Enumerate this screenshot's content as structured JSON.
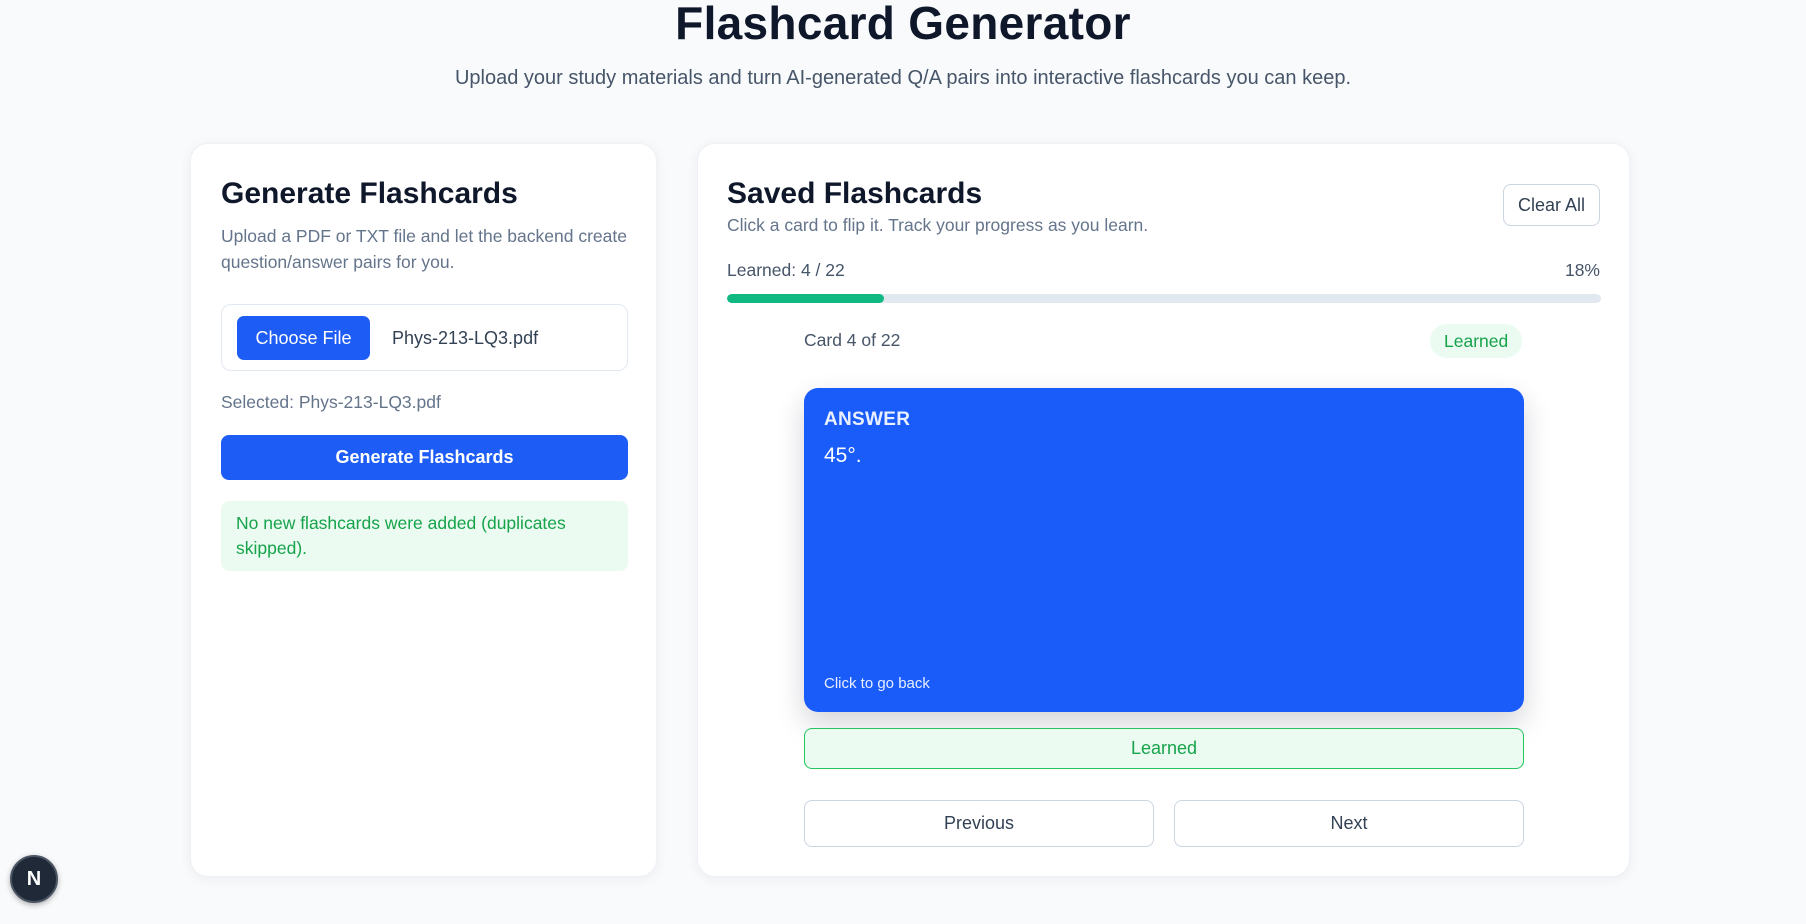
{
  "header": {
    "title": "Flashcard Generator",
    "subtitle": "Upload your study materials and turn AI-generated Q/A pairs into interactive flashcards you can keep."
  },
  "generate": {
    "heading": "Generate Flashcards",
    "description": "Upload a PDF or TXT file and let the backend create question/answer pairs for you.",
    "choose_file_label": "Choose File",
    "file_name": "Phys-213-LQ3.pdf",
    "selected_text": "Selected: Phys-213-LQ3.pdf",
    "generate_button": "Generate Flashcards",
    "notice": "No new flashcards were added (duplicates skipped)."
  },
  "saved": {
    "heading": "Saved Flashcards",
    "description": "Click a card to flip it. Track your progress as you learn.",
    "clear_all": "Clear All",
    "learned_label": "Learned: 4 / 22",
    "percent_label": "18%",
    "progress_fraction": 0.18,
    "card_counter": "Card 4 of 22",
    "status_badge": "Learned",
    "card": {
      "side_label": "ANSWER",
      "text": "45°.",
      "hint": "Click to go back",
      "color": "#1a5cfa"
    },
    "learned_button": "Learned",
    "previous": "Previous",
    "next": "Next"
  },
  "dev_badge": {
    "label": "N",
    "icon": "nextjs-icon"
  },
  "colors": {
    "accent": "#1d5cf5",
    "success": "#16a34a",
    "progress": "#10b981"
  }
}
